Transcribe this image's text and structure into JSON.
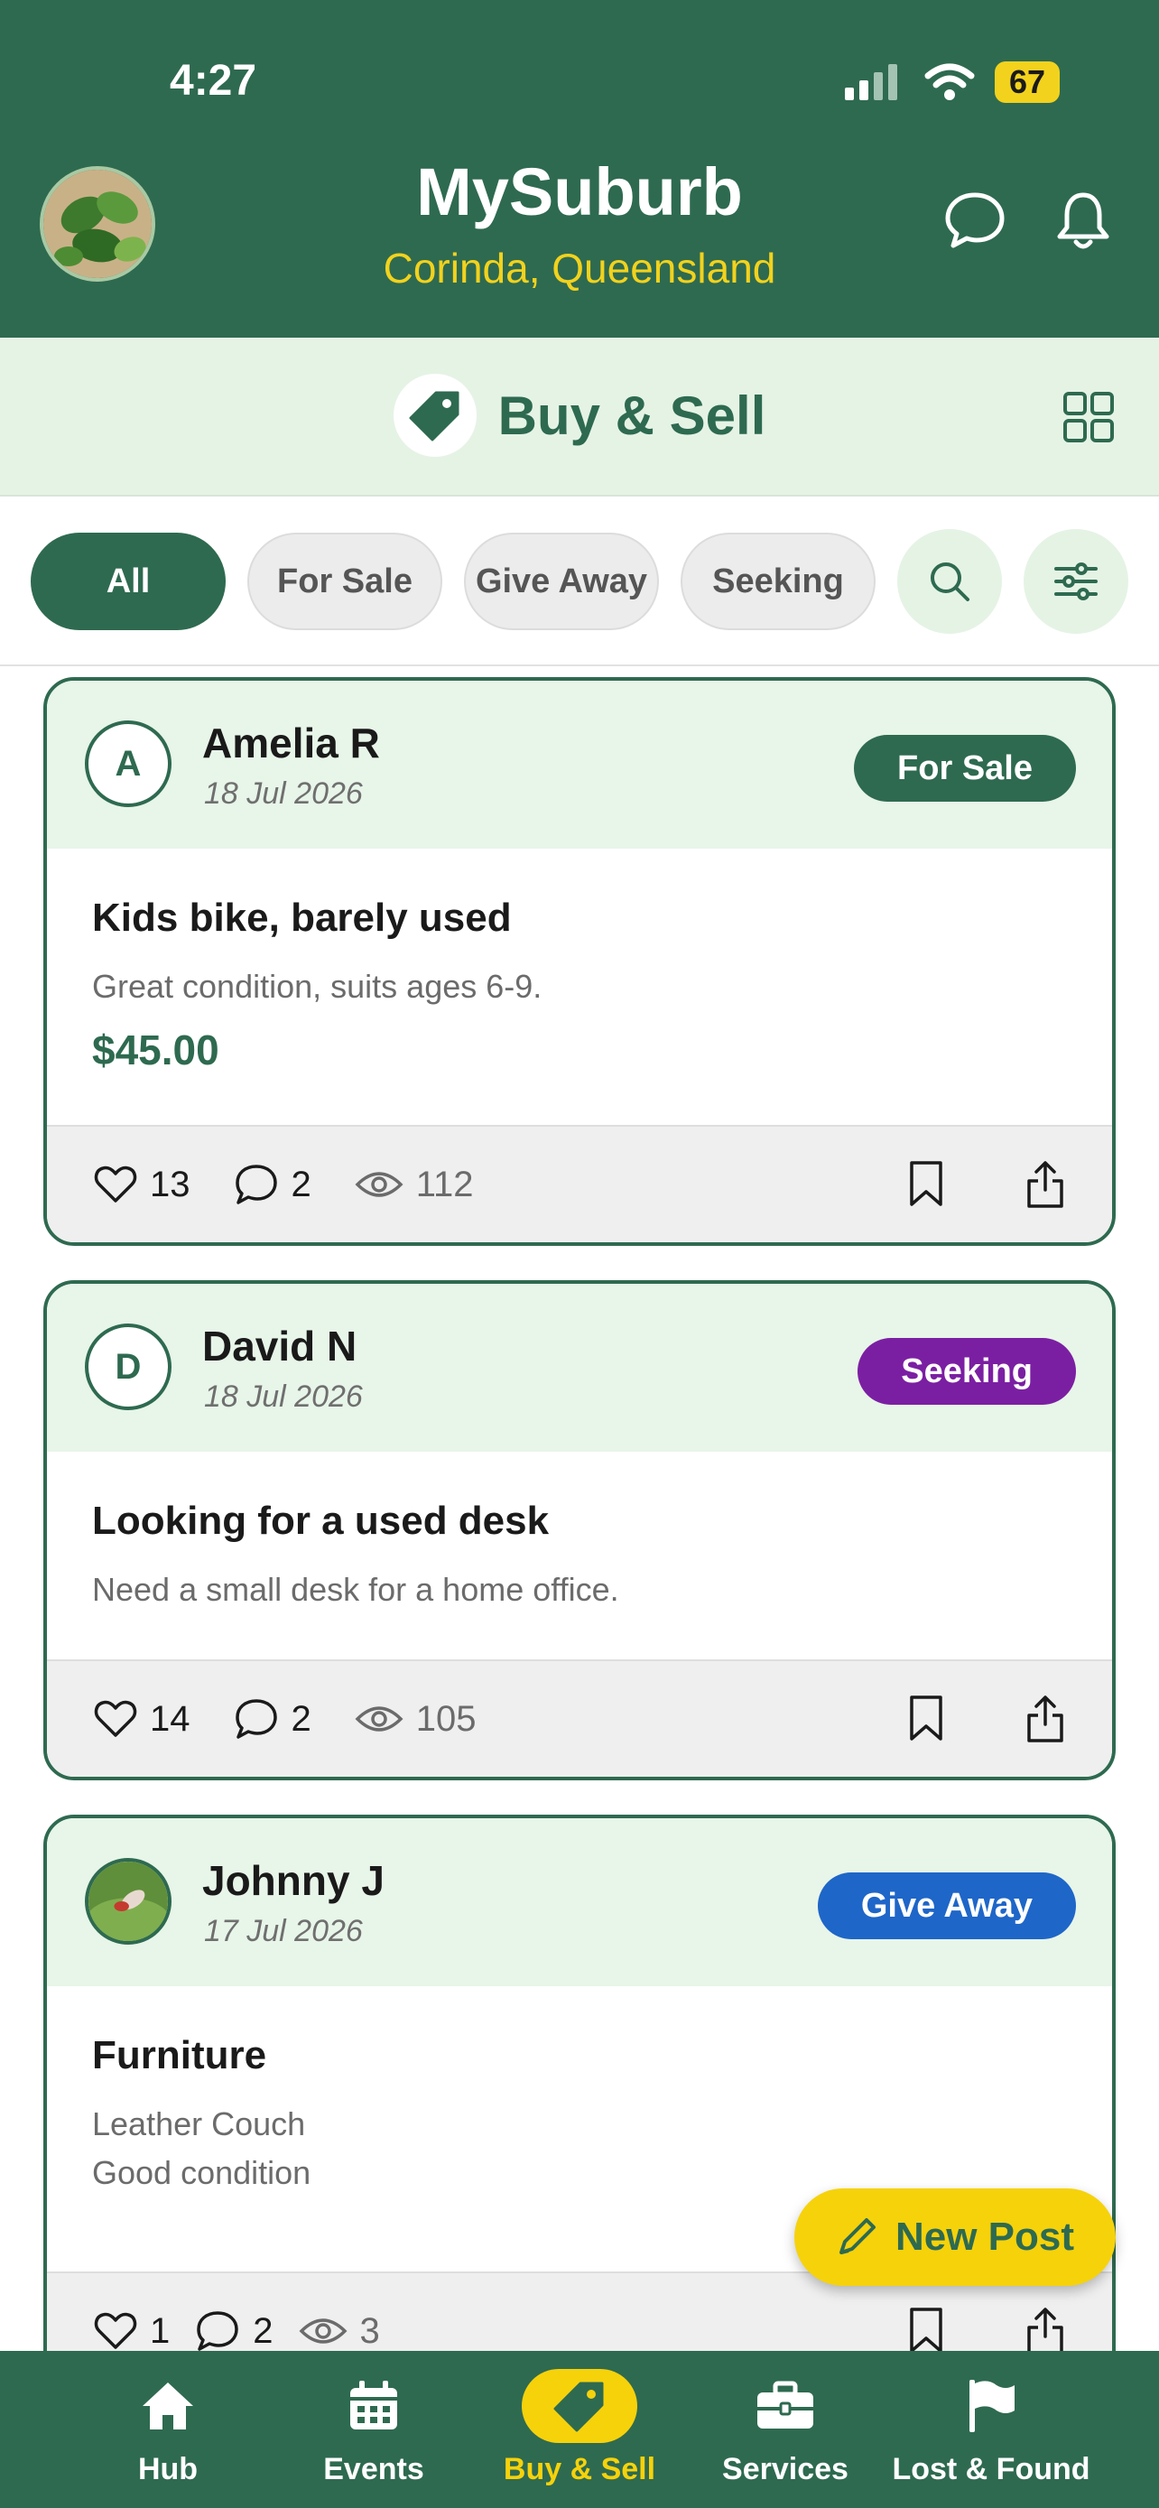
{
  "status_bar": {
    "time": "4:27",
    "battery": "67"
  },
  "header": {
    "title": "MySuburb",
    "subtitle": "Corinda, Queensland"
  },
  "section": {
    "title": "Buy & Sell"
  },
  "filters": {
    "chips": [
      "All",
      "For Sale",
      "Give Away",
      "Seeking"
    ],
    "active": "All"
  },
  "posts": [
    {
      "initial": "A",
      "author": "Amelia R",
      "date": "18 Jul 2026",
      "badge": "For Sale",
      "badge_color": "#2e6a50",
      "title": "Kids bike, barely used",
      "desc": [
        "Great condition, suits ages 6-9."
      ],
      "price": "$45.00",
      "likes": "13",
      "comments": "2",
      "views": "112"
    },
    {
      "initial": "D",
      "author": "David N",
      "date": "18 Jul 2026",
      "badge": "Seeking",
      "badge_color": "#7b1fa2",
      "title": "Looking for a used desk",
      "desc": [
        "Need a small desk for a home office."
      ],
      "likes": "14",
      "comments": "2",
      "views": "105"
    },
    {
      "initial": "",
      "author": "Johnny J",
      "date": "17 Jul 2026",
      "badge": "Give Away",
      "badge_color": "#1e66c8",
      "title": "Furniture",
      "desc": [
        "Leather Couch",
        "Good condition"
      ],
      "likes": "1",
      "comments": "2",
      "views": "3"
    }
  ],
  "fab": {
    "label": "New Post"
  },
  "bottom_nav": {
    "items": [
      "Hub",
      "Events",
      "Buy & Sell",
      "Services",
      "Lost & Found"
    ],
    "active": "Buy & Sell"
  },
  "colors": {
    "primary": "#2e6a50",
    "accent": "#f6d20b",
    "light_green": "#e5f3e5"
  }
}
